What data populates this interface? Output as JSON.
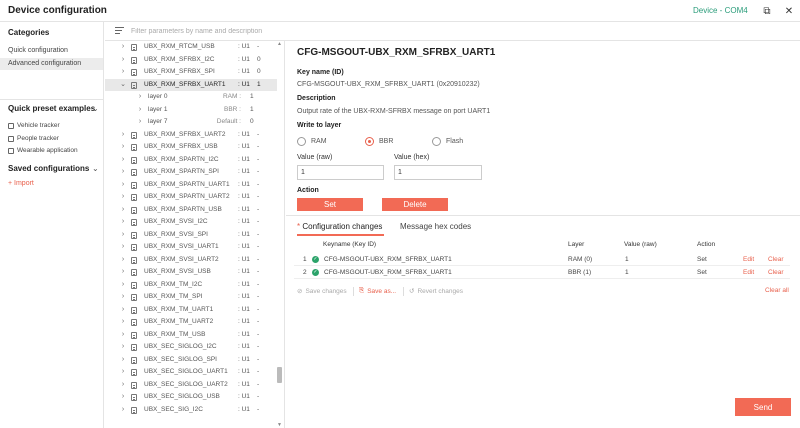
{
  "titlebar": {
    "title": "Device configuration",
    "device": "Device - COM4",
    "popout_glyph": "⧉",
    "close_glyph": "✕"
  },
  "sidebar": {
    "categories_header": "Categories",
    "categories": [
      {
        "label": "Quick configuration",
        "active": false
      },
      {
        "label": "Advanced configuration",
        "active": true
      }
    ],
    "presets_header": "Quick preset examples",
    "presets": [
      "Vehicle tracker",
      "People tracker",
      "Wearable application"
    ],
    "saved_header": "Saved configurations",
    "import_label": "+ Import"
  },
  "filter": {
    "placeholder": "Filter parameters by name and description"
  },
  "tree": {
    "rows": [
      {
        "kind": "item",
        "name": "UBX_RXM_RTCM_USB",
        "type": ": U1",
        "value": "-",
        "expanded": false
      },
      {
        "kind": "item",
        "name": "UBX_RXM_SFRBX_I2C",
        "type": ": U1",
        "value": "0",
        "expanded": false
      },
      {
        "kind": "item",
        "name": "UBX_RXM_SFRBX_SPI",
        "type": ": U1",
        "value": "0",
        "expanded": false
      },
      {
        "kind": "item",
        "name": "UBX_RXM_SFRBX_UART1",
        "type": ": U1",
        "value": "1",
        "expanded": true,
        "selected": true
      },
      {
        "kind": "layer",
        "name": "layer 0",
        "tag": "RAM :",
        "value": "1"
      },
      {
        "kind": "layer",
        "name": "layer 1",
        "tag": "BBR :",
        "value": "1"
      },
      {
        "kind": "layer",
        "name": "layer 7",
        "tag": "Default :",
        "value": "0"
      },
      {
        "kind": "item",
        "name": "UBX_RXM_SFRBX_UART2",
        "type": ": U1",
        "value": "-",
        "expanded": false
      },
      {
        "kind": "item",
        "name": "UBX_RXM_SFRBX_USB",
        "type": ": U1",
        "value": "-",
        "expanded": false
      },
      {
        "kind": "item",
        "name": "UBX_RXM_SPARTN_I2C",
        "type": ": U1",
        "value": "-",
        "expanded": false
      },
      {
        "kind": "item",
        "name": "UBX_RXM_SPARTN_SPI",
        "type": ": U1",
        "value": "-",
        "expanded": false
      },
      {
        "kind": "item",
        "name": "UBX_RXM_SPARTN_UART1",
        "type": ": U1",
        "value": "-",
        "expanded": false
      },
      {
        "kind": "item",
        "name": "UBX_RXM_SPARTN_UART2",
        "type": ": U1",
        "value": "-",
        "expanded": false
      },
      {
        "kind": "item",
        "name": "UBX_RXM_SPARTN_USB",
        "type": ": U1",
        "value": "-",
        "expanded": false
      },
      {
        "kind": "item",
        "name": "UBX_RXM_SVSI_I2C",
        "type": ": U1",
        "value": "-",
        "expanded": false
      },
      {
        "kind": "item",
        "name": "UBX_RXM_SVSI_SPI",
        "type": ": U1",
        "value": "-",
        "expanded": false
      },
      {
        "kind": "item",
        "name": "UBX_RXM_SVSI_UART1",
        "type": ": U1",
        "value": "-",
        "expanded": false
      },
      {
        "kind": "item",
        "name": "UBX_RXM_SVSI_UART2",
        "type": ": U1",
        "value": "-",
        "expanded": false
      },
      {
        "kind": "item",
        "name": "UBX_RXM_SVSI_USB",
        "type": ": U1",
        "value": "-",
        "expanded": false
      },
      {
        "kind": "item",
        "name": "UBX_RXM_TM_I2C",
        "type": ": U1",
        "value": "-",
        "expanded": false
      },
      {
        "kind": "item",
        "name": "UBX_RXM_TM_SPI",
        "type": ": U1",
        "value": "-",
        "expanded": false
      },
      {
        "kind": "item",
        "name": "UBX_RXM_TM_UART1",
        "type": ": U1",
        "value": "-",
        "expanded": false
      },
      {
        "kind": "item",
        "name": "UBX_RXM_TM_UART2",
        "type": ": U1",
        "value": "-",
        "expanded": false
      },
      {
        "kind": "item",
        "name": "UBX_RXM_TM_USB",
        "type": ": U1",
        "value": "-",
        "expanded": false
      },
      {
        "kind": "item",
        "name": "UBX_SEC_SIGLOG_I2C",
        "type": ": U1",
        "value": "-",
        "expanded": false
      },
      {
        "kind": "item",
        "name": "UBX_SEC_SIGLOG_SPI",
        "type": ": U1",
        "value": "-",
        "expanded": false
      },
      {
        "kind": "item",
        "name": "UBX_SEC_SIGLOG_UART1",
        "type": ": U1",
        "value": "-",
        "expanded": false
      },
      {
        "kind": "item",
        "name": "UBX_SEC_SIGLOG_UART2",
        "type": ": U1",
        "value": "-",
        "expanded": false
      },
      {
        "kind": "item",
        "name": "UBX_SEC_SIGLOG_USB",
        "type": ": U1",
        "value": "-",
        "expanded": false
      },
      {
        "kind": "item",
        "name": "UBX_SEC_SIG_I2C",
        "type": ": U1",
        "value": "-",
        "expanded": false
      }
    ]
  },
  "detail": {
    "title": "CFG-MSGOUT-UBX_RXM_SFRBX_UART1",
    "key_name_label": "Key name (ID)",
    "key_name_value": "CFG-MSGOUT-UBX_RXM_SFRBX_UART1 (0x20910232)",
    "description_label": "Description",
    "description_value": "Output rate of the UBX-RXM-SFRBX message on port UART1",
    "write_label": "Write to layer",
    "layers": [
      {
        "label": "RAM",
        "checked": false
      },
      {
        "label": "BBR",
        "checked": true
      },
      {
        "label": "Flash",
        "checked": false
      }
    ],
    "value_raw_label": "Value (raw)",
    "value_raw": "1",
    "value_hex_label": "Value (hex)",
    "value_hex": "1",
    "action_label": "Action",
    "set_label": "Set",
    "delete_label": "Delete",
    "accent_color": "#f26a55"
  },
  "changes": {
    "tabs": [
      {
        "asterisk": "* ",
        "label": "Configuration changes",
        "active": true
      },
      {
        "label": "Message hex codes",
        "active": false
      }
    ],
    "headers": {
      "key": "Keyname (Key ID)",
      "layer": "Layer",
      "value": "Value (raw)",
      "action": "Action"
    },
    "rows": [
      {
        "index": "1",
        "key": "CFG-MSGOUT-UBX_RXM_SFRBX_UART1",
        "layer": "RAM (0)",
        "value": "1",
        "action": "Set",
        "edit": "Edit",
        "clear": "Clear"
      },
      {
        "index": "2",
        "key": "CFG-MSGOUT-UBX_RXM_SFRBX_UART1",
        "layer": "BBR (1)",
        "value": "1",
        "action": "Set",
        "edit": "Edit",
        "clear": "Clear"
      }
    ],
    "save_changes": "Save changes",
    "save_as": "Save as...",
    "revert_changes": "Revert changes",
    "clear_all": "Clear all",
    "send_label": "Send"
  }
}
